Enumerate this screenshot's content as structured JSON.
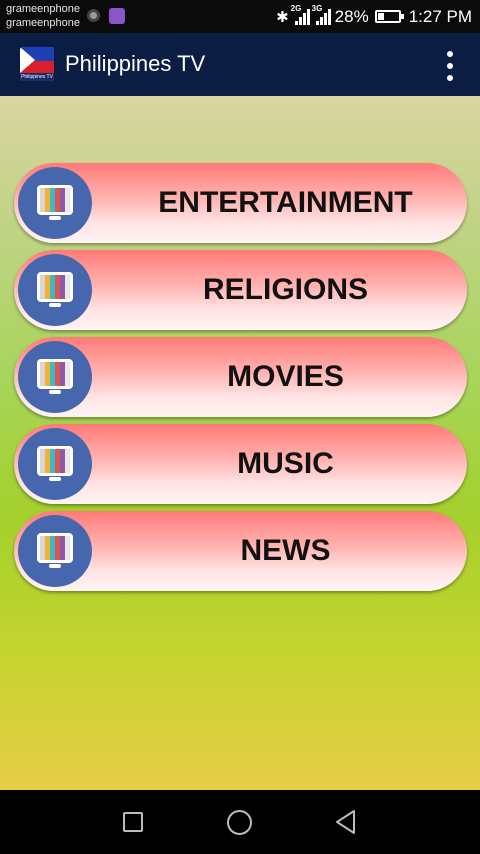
{
  "status_bar": {
    "carrier_1": "grameenphone",
    "carrier_2": "grameenphone",
    "network_1": "2G",
    "network_2": "3G",
    "battery": "28%",
    "battery_level": 0.28,
    "time": "1:27 PM"
  },
  "app_bar": {
    "title": "Philippines TV",
    "logo_caption": "Philippines TV"
  },
  "menu": [
    {
      "label": "ENTERTAINMENT",
      "icon": "tv-icon"
    },
    {
      "label": "RELIGIONS",
      "icon": "tv-icon"
    },
    {
      "label": "MOVIES",
      "icon": "tv-icon"
    },
    {
      "label": "MUSIC",
      "icon": "tv-icon"
    },
    {
      "label": "NEWS",
      "icon": "tv-icon"
    }
  ],
  "colors": {
    "app_bar": "#0c1d44",
    "button_top": "#ff7a78",
    "icon_circle": "#4667ad"
  }
}
